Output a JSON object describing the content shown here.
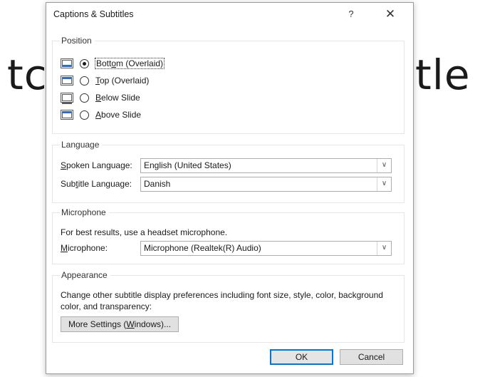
{
  "background": {
    "left_text": "tc",
    "right_text": "tle"
  },
  "dialog": {
    "title": "Captions & Subtitles",
    "help_label": "?",
    "close_label": "✕"
  },
  "position": {
    "title": "Position",
    "options": [
      {
        "label": "Bottom (Overlaid)",
        "selected": true
      },
      {
        "label": "Top (Overlaid)",
        "selected": false
      },
      {
        "label": "Below Slide",
        "selected": false
      },
      {
        "label": "Above Slide",
        "selected": false
      }
    ]
  },
  "language": {
    "title": "Language",
    "spoken_label": "Spoken Language:",
    "spoken_value": "English (United States)",
    "subtitle_label": "Subtitle Language:",
    "subtitle_value": "Danish"
  },
  "microphone": {
    "title": "Microphone",
    "hint": "For best results, use a headset microphone.",
    "label": "Microphone:",
    "value": "Microphone (Realtek(R) Audio)"
  },
  "appearance": {
    "title": "Appearance",
    "description": "Change other subtitle display preferences including font size, style, color, background color, and transparency:",
    "more_settings_label": "More Settings (Windows)..."
  },
  "footer": {
    "ok_label": "OK",
    "cancel_label": "Cancel"
  },
  "colors": {
    "accent": "#0078d7",
    "icon_bar": "#2b6cc4"
  },
  "icons": {
    "dropdown": "chevron-down-icon",
    "close": "close-icon",
    "help": "help-icon"
  }
}
